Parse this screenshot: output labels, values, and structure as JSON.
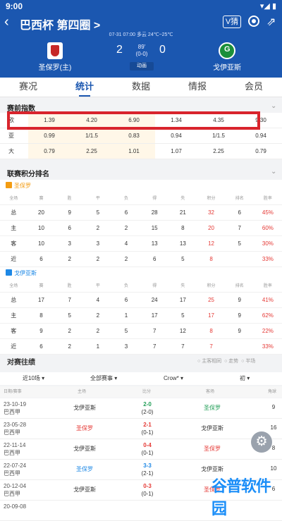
{
  "status": {
    "time": "9:00",
    "right": "▾◢ ▮"
  },
  "header": {
    "back": "‹",
    "title": "巴西杯 第四圈 >",
    "vbtn": "V猜",
    "share": "⇗",
    "info": "07-31 07:00   多云 24℃~25℃",
    "home_name": "圣保罗(主)",
    "away_name": "戈伊亚斯",
    "home_score": "2",
    "away_score": "0",
    "minute": "89'",
    "half": "(0-0)",
    "anim": "动画"
  },
  "tabs": [
    "赛况",
    "统计",
    "数据",
    "情报",
    "会员"
  ],
  "odds": {
    "title": "赛前指数",
    "rows": [
      {
        "label": "欧",
        "vals": [
          "1.39",
          "4.20",
          "6.90",
          "1.34",
          "4.35",
          "9.30"
        ]
      },
      {
        "label": "亚",
        "vals": [
          "0.99",
          "1/1.5",
          "0.83",
          "0.94",
          "1/1.5",
          "0.94"
        ]
      },
      {
        "label": "大",
        "vals": [
          "0.79",
          "2.25",
          "1.01",
          "1.07",
          "2.25",
          "0.79"
        ]
      }
    ]
  },
  "league": {
    "title": "联赛积分排名",
    "headers": [
      "全场",
      "赛",
      "胜",
      "平",
      "负",
      "得",
      "失",
      "积分",
      "排名",
      "胜率"
    ],
    "teams": [
      {
        "name": "圣保罗",
        "color": "#f39c12",
        "rows": [
          [
            "总",
            "20",
            "9",
            "5",
            "6",
            "28",
            "21",
            "32",
            "6",
            "45%"
          ],
          [
            "主",
            "10",
            "6",
            "2",
            "2",
            "15",
            "8",
            "20",
            "7",
            "60%"
          ],
          [
            "客",
            "10",
            "3",
            "3",
            "4",
            "13",
            "13",
            "12",
            "5",
            "30%"
          ],
          [
            "近",
            "6",
            "2",
            "2",
            "2",
            "6",
            "5",
            "8",
            "",
            "33%"
          ]
        ]
      },
      {
        "name": "戈伊亚斯",
        "color": "#1e88e5",
        "rows": [
          [
            "总",
            "17",
            "7",
            "4",
            "6",
            "24",
            "17",
            "25",
            "9",
            "41%"
          ],
          [
            "主",
            "8",
            "5",
            "2",
            "1",
            "17",
            "5",
            "17",
            "9",
            "62%"
          ],
          [
            "客",
            "9",
            "2",
            "2",
            "5",
            "7",
            "12",
            "8",
            "9",
            "22%"
          ],
          [
            "近",
            "6",
            "2",
            "1",
            "3",
            "7",
            "7",
            "7",
            "",
            "33%"
          ]
        ]
      }
    ]
  },
  "history": {
    "title": "对赛往绩",
    "opts": [
      "主客相同",
      "走势",
      "半场"
    ],
    "filters": [
      "近10场 ▾",
      "全部赛事 ▾",
      "Crow* ▾",
      "初 ▾"
    ],
    "headers": [
      "日期/赛事",
      "主场",
      "比分",
      "客场",
      "角球"
    ],
    "rows": [
      {
        "date": "23-10-19",
        "comp": "巴西甲",
        "home": "戈伊亚斯",
        "home_c": "#333",
        "score": "2-0",
        "half": "(2-0)",
        "sc_c": "#1f9d55",
        "away": "圣保罗",
        "away_c": "#1f9d55",
        "corners": "9"
      },
      {
        "date": "23-05-28",
        "comp": "巴西甲",
        "home": "圣保罗",
        "home_c": "#e53935",
        "score": "2-1",
        "half": "(0-1)",
        "sc_c": "#e53935",
        "away": "戈伊亚斯",
        "away_c": "#333",
        "corners": "16"
      },
      {
        "date": "22-11-14",
        "comp": "巴西甲",
        "home": "戈伊亚斯",
        "home_c": "#333",
        "score": "0-4",
        "half": "(0-1)",
        "sc_c": "#e53935",
        "away": "圣保罗",
        "away_c": "#e53935",
        "corners": "8"
      },
      {
        "date": "22-07-24",
        "comp": "巴西甲",
        "home": "圣保罗",
        "home_c": "#1e88e5",
        "score": "3-3",
        "half": "(2-1)",
        "sc_c": "#1e88e5",
        "away": "戈伊亚斯",
        "away_c": "#333",
        "corners": "10"
      },
      {
        "date": "20-12-04",
        "comp": "巴西甲",
        "home": "戈伊亚斯",
        "home_c": "#333",
        "score": "0-3",
        "half": "(0-1)",
        "sc_c": "#e53935",
        "away": "圣保罗",
        "away_c": "#e53935",
        "corners": "6"
      },
      {
        "date": "20-09-08",
        "comp": "",
        "home": "",
        "home_c": "#333",
        "score": "",
        "half": "",
        "sc_c": "#333",
        "away": "",
        "away_c": "#333",
        "corners": ""
      }
    ]
  },
  "watermark": "谷普软件园"
}
